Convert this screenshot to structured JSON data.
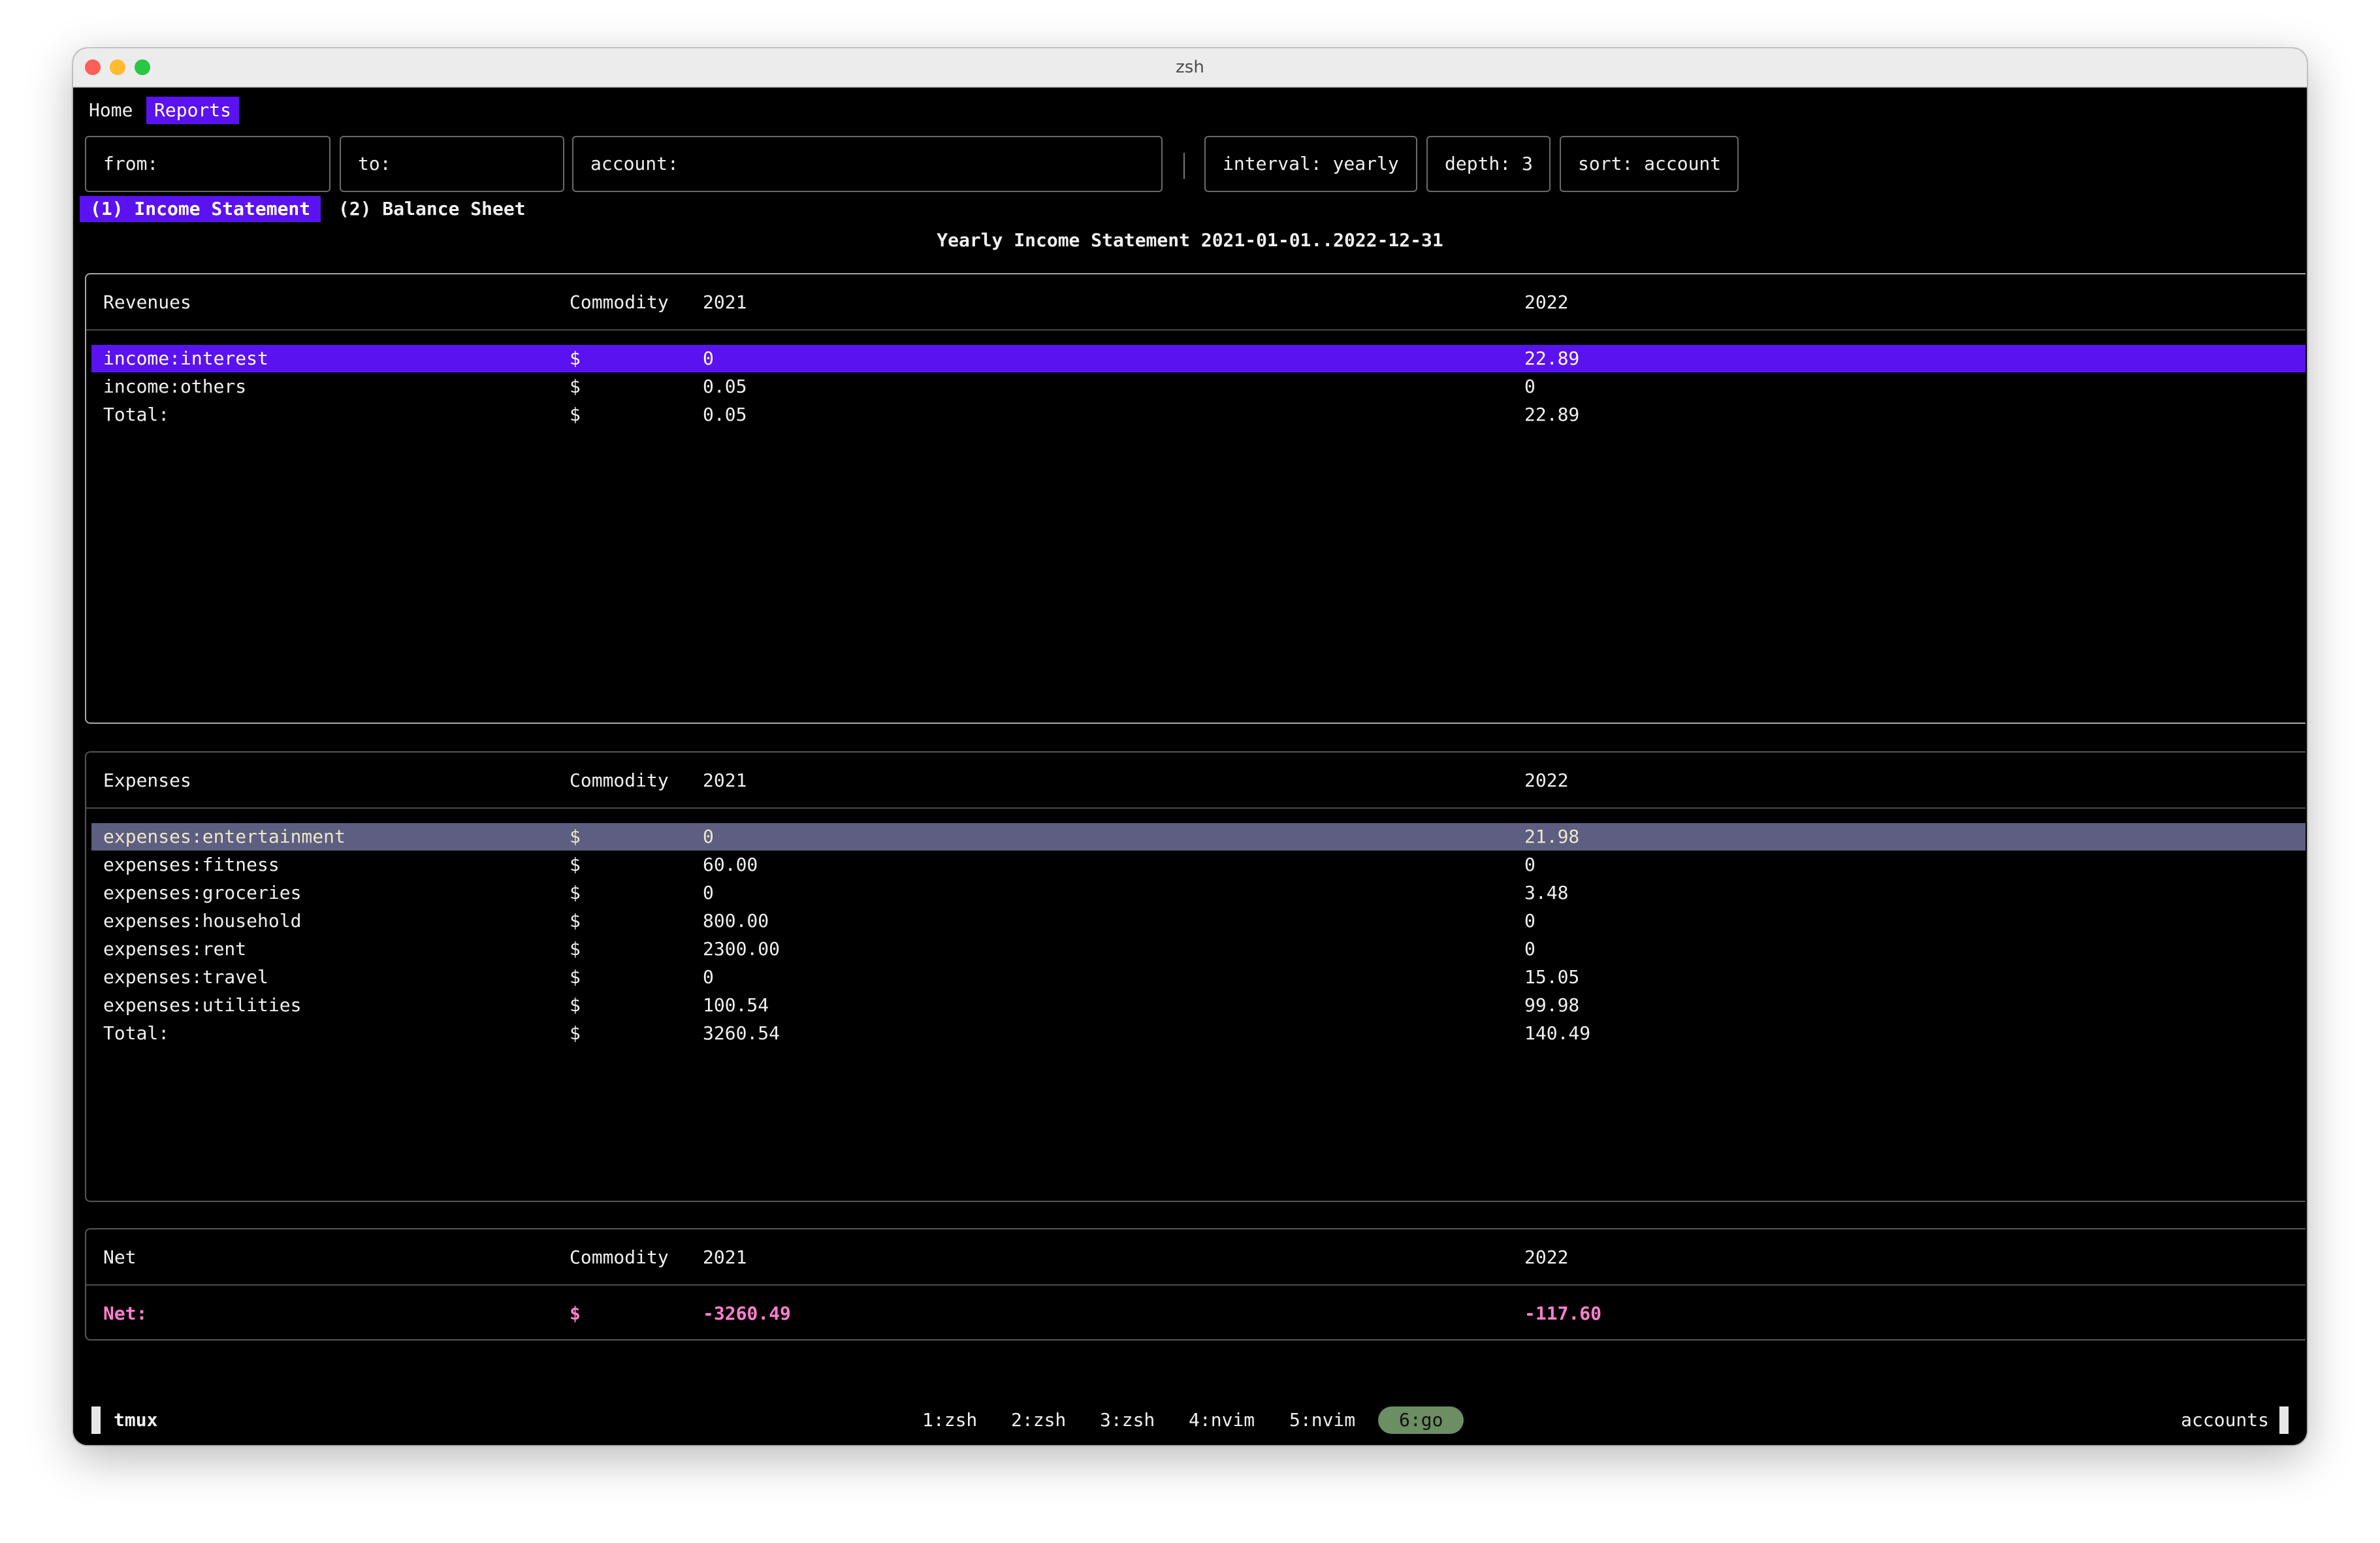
{
  "window": {
    "title": "zsh"
  },
  "nav": {
    "home": "Home",
    "reports": "Reports"
  },
  "filters": {
    "from": "from:",
    "to": "to:",
    "account": "account:",
    "interval": "interval: yearly",
    "depth": "depth: 3",
    "sort": "sort: account"
  },
  "report_tabs": {
    "income_statement": "(1) Income Statement",
    "balance_sheet": "(2) Balance Sheet"
  },
  "report_title": "Yearly Income Statement 2021-01-01..2022-12-31",
  "revenues": {
    "headers": [
      "Revenues",
      "Commodity",
      "2021",
      "2022"
    ],
    "rows": [
      [
        "income:interest",
        "$",
        "0",
        "22.89"
      ],
      [
        "income:others",
        "$",
        "0.05",
        "0"
      ],
      [
        "Total:",
        "$",
        "0.05",
        "22.89"
      ]
    ]
  },
  "expenses": {
    "headers": [
      "Expenses",
      "Commodity",
      "2021",
      "2022"
    ],
    "rows": [
      [
        "expenses:entertainment",
        "$",
        "0",
        "21.98"
      ],
      [
        "expenses:fitness",
        "$",
        "60.00",
        "0"
      ],
      [
        "expenses:groceries",
        "$",
        "0",
        "3.48"
      ],
      [
        "expenses:household",
        "$",
        "800.00",
        "0"
      ],
      [
        "expenses:rent",
        "$",
        "2300.00",
        "0"
      ],
      [
        "expenses:travel",
        "$",
        "0",
        "15.05"
      ],
      [
        "expenses:utilities",
        "$",
        "100.54",
        "99.98"
      ],
      [
        "Total:",
        "$",
        "3260.54",
        "140.49"
      ]
    ]
  },
  "net": {
    "headers": [
      "Net",
      "Commodity",
      "2021",
      "2022"
    ],
    "rows": [
      [
        "Net:",
        "$",
        "-3260.49",
        "-117.60"
      ]
    ]
  },
  "status_bar": {
    "session": "tmux",
    "windows": [
      "1:zsh",
      "2:zsh",
      "3:zsh",
      "4:nvim",
      "5:nvim",
      "6:go"
    ],
    "right": "accounts"
  },
  "colors": {
    "accent": "#5b12f0",
    "selected_row_expenses": "#5d5e82",
    "net_text": "#ff7fd0",
    "active_window_pill": "#6b8e62"
  }
}
